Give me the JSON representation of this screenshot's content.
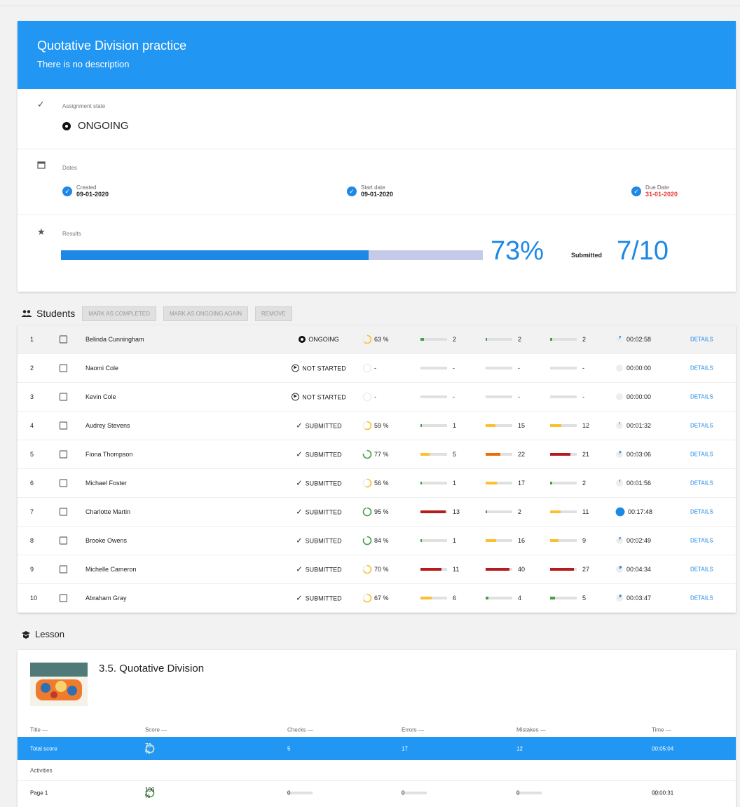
{
  "assignment": {
    "title": "Quotative Division practice",
    "description": "There is no description",
    "state_label": "Assignment state",
    "state_value": "ONGOING",
    "dates_label": "Dates",
    "created_label": "Created",
    "created_value": "09-01-2020",
    "start_label": "Start date",
    "start_value": "09-01-2020",
    "due_label": "Due Date",
    "due_value": "31-01-2020",
    "results_label": "Results",
    "results_percent": "73%",
    "results_progress": 0.73,
    "submitted_label": "Submitted",
    "submitted_value": "7/10"
  },
  "students": {
    "title": "Students",
    "buttons": [
      "MARK AS COMPLETED",
      "MARK AS ONGOING AGAIN",
      "REMOVE"
    ],
    "details_label": "DETAILS",
    "rows": [
      {
        "num": "1",
        "name": "Belinda Cunningham",
        "status": "ONGOING",
        "score": "63 %",
        "score_frac": 0.63,
        "score_color": "#fbc02d",
        "checks": "2",
        "checks_frac": 0.12,
        "checks_color": "#43a047",
        "errors": "2",
        "errors_frac": 0.05,
        "errors_color": "#43a047",
        "mistakes": "2",
        "mistakes_frac": 0.08,
        "mistakes_color": "#43a047",
        "time": "00:02:58",
        "time_frac": 0.08
      },
      {
        "num": "2",
        "name": "Naomi Cole",
        "status": "NOT STARTED",
        "score": "-",
        "score_frac": 0,
        "score_color": "#e0e0e0",
        "checks": "-",
        "checks_frac": 0,
        "checks_color": "#e0e0e0",
        "errors": "-",
        "errors_frac": 0,
        "errors_color": "#e0e0e0",
        "mistakes": "-",
        "mistakes_frac": 0,
        "mistakes_color": "#e0e0e0",
        "time": "00:00:00",
        "time_frac": 0
      },
      {
        "num": "3",
        "name": "Kevin Cole",
        "status": "NOT STARTED",
        "score": "-",
        "score_frac": 0,
        "score_color": "#e0e0e0",
        "checks": "-",
        "checks_frac": 0,
        "checks_color": "#e0e0e0",
        "errors": "-",
        "errors_frac": 0,
        "errors_color": "#e0e0e0",
        "mistakes": "-",
        "mistakes_frac": 0,
        "mistakes_color": "#e0e0e0",
        "time": "00:00:00",
        "time_frac": 0
      },
      {
        "num": "4",
        "name": "Audrey Stevens",
        "status": "SUBMITTED",
        "score": "59 %",
        "score_frac": 0.59,
        "score_color": "#fbc02d",
        "checks": "1",
        "checks_frac": 0.06,
        "checks_color": "#43a047",
        "errors": "15",
        "errors_frac": 0.38,
        "errors_color": "#fbc02d",
        "mistakes": "12",
        "mistakes_frac": 0.42,
        "mistakes_color": "#fbc02d",
        "time": "00:01:32",
        "time_frac": 0.04
      },
      {
        "num": "5",
        "name": "Fiona Thompson",
        "status": "SUBMITTED",
        "score": "77 %",
        "score_frac": 0.77,
        "score_color": "#43a047",
        "checks": "5",
        "checks_frac": 0.35,
        "checks_color": "#fbc02d",
        "errors": "22",
        "errors_frac": 0.55,
        "errors_color": "#ef6c00",
        "mistakes": "21",
        "mistakes_frac": 0.75,
        "mistakes_color": "#b71c1c",
        "time": "00:03:06",
        "time_frac": 0.1
      },
      {
        "num": "6",
        "name": "Michael Foster",
        "status": "SUBMITTED",
        "score": "56 %",
        "score_frac": 0.56,
        "score_color": "#fbc02d",
        "checks": "1",
        "checks_frac": 0.06,
        "checks_color": "#43a047",
        "errors": "17",
        "errors_frac": 0.42,
        "errors_color": "#fbc02d",
        "mistakes": "2",
        "mistakes_frac": 0.08,
        "mistakes_color": "#43a047",
        "time": "00:01:56",
        "time_frac": 0.05
      },
      {
        "num": "7",
        "name": "Charlotte Martin",
        "status": "SUBMITTED",
        "score": "95 %",
        "score_frac": 0.95,
        "score_color": "#43a047",
        "checks": "13",
        "checks_frac": 0.95,
        "checks_color": "#b71c1c",
        "errors": "2",
        "errors_frac": 0.05,
        "errors_color": "#43a047",
        "mistakes": "11",
        "mistakes_frac": 0.4,
        "mistakes_color": "#fbc02d",
        "time": "00:17:48",
        "time_frac": 1
      },
      {
        "num": "8",
        "name": "Brooke Owens",
        "status": "SUBMITTED",
        "score": "84 %",
        "score_frac": 0.84,
        "score_color": "#43a047",
        "checks": "1",
        "checks_frac": 0.06,
        "checks_color": "#43a047",
        "errors": "16",
        "errors_frac": 0.4,
        "errors_color": "#fbc02d",
        "mistakes": "9",
        "mistakes_frac": 0.32,
        "mistakes_color": "#fbc02d",
        "time": "00:02:49",
        "time_frac": 0.08
      },
      {
        "num": "9",
        "name": "Michelle Cameron",
        "status": "SUBMITTED",
        "score": "70 %",
        "score_frac": 0.7,
        "score_color": "#fbc02d",
        "checks": "11",
        "checks_frac": 0.8,
        "checks_color": "#b71c1c",
        "errors": "40",
        "errors_frac": 0.9,
        "errors_color": "#b71c1c",
        "mistakes": "27",
        "mistakes_frac": 0.9,
        "mistakes_color": "#b71c1c",
        "time": "00:04:34",
        "time_frac": 0.14
      },
      {
        "num": "10",
        "name": "Abraham Gray",
        "status": "SUBMITTED",
        "score": "67 %",
        "score_frac": 0.67,
        "score_color": "#fbc02d",
        "checks": "6",
        "checks_frac": 0.42,
        "checks_color": "#fbc02d",
        "errors": "4",
        "errors_frac": 0.1,
        "errors_color": "#43a047",
        "mistakes": "5",
        "mistakes_frac": 0.18,
        "mistakes_color": "#43a047",
        "time": "00:03:47",
        "time_frac": 0.12
      }
    ]
  },
  "lesson": {
    "label": "Lesson",
    "title": "3.5. Quotative Division",
    "columns": [
      "Title —",
      "Score —",
      "Checks —",
      "Errors —",
      "Mistakes —",
      "Time —"
    ],
    "total": {
      "title": "Total score",
      "score": "73 %",
      "checks": "5",
      "errors": "17",
      "mistakes": "12",
      "time": "00:05:04"
    },
    "activities_label": "Activities",
    "rows": [
      {
        "title": "Page 1",
        "score": "100 %",
        "checks": "0",
        "errors": "0",
        "mistakes": "0",
        "time": "00:00:31"
      }
    ]
  },
  "colors": {
    "accent": "#2196f3",
    "due_date": "#e53935",
    "good": "#43a047",
    "warn": "#fbc02d",
    "bad": "#b71c1c"
  }
}
